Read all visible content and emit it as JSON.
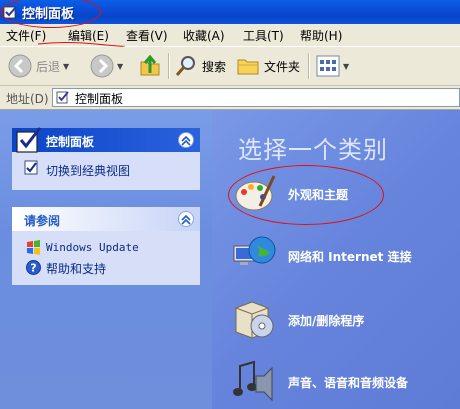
{
  "window": {
    "title": "控制面板"
  },
  "menu": [
    "文件(F)",
    "编辑(E)",
    "查看(V)",
    "收藏(A)",
    "工具(T)",
    "帮助(H)"
  ],
  "toolbar": {
    "back": "后退",
    "search": "搜索",
    "folders": "文件夹"
  },
  "address": {
    "label": "地址(D)",
    "value": "控制面板"
  },
  "left": {
    "panel1_title": "控制面板",
    "panel1_link": "切换到经典视图",
    "panel2_title": "请参阅",
    "panel2_links": [
      "Windows Update",
      "帮助和支持"
    ]
  },
  "main": {
    "heading": "选择一个类别",
    "categories": [
      "外观和主题",
      "网络和 Internet 连接",
      "添加/删除程序",
      "声音、语音和音频设备"
    ]
  },
  "colors": {
    "titlebar": "#0a4bd6",
    "left_pane": "#6e8fdc",
    "right_pane": "#6684dc",
    "annotation": "#e01010"
  }
}
